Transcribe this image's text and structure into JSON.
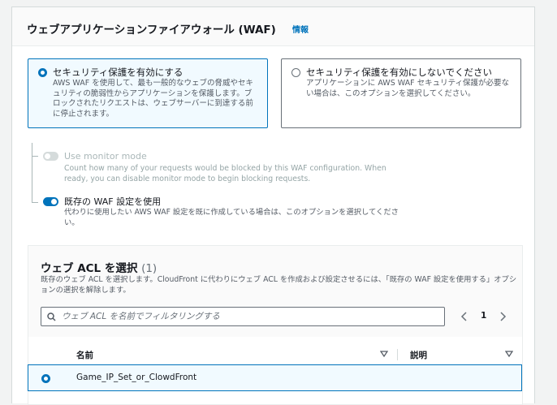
{
  "panel": {
    "title": "ウェブアプリケーションファイアウォール (WAF)",
    "info_link": "情報"
  },
  "protection_options": [
    {
      "label": "セキュリティ保護を有効にする",
      "description": "AWS WAF を使用して、最も一般的なウェブの脅威やセキュリティの脆弱性からアプリケーションを保護します。ブロックされたリクエストは、ウェブサーバーに到達する前に停止されます。",
      "selected": true
    },
    {
      "label": "セキュリティ保護を有効にしないでください",
      "description": "アプリケーションに AWS WAF セキュリティ保護が必要ない場合は、このオプションを選択してください。",
      "selected": false
    }
  ],
  "monitor_mode": {
    "label": "Use monitor mode",
    "description": "Count how many of your requests would be blocked by this WAF configuration. When ready, you can disable monitor mode to begin blocking requests.",
    "enabled": false
  },
  "existing_waf": {
    "label": "既存の WAF 設定を使用",
    "description": "代わりに使用したい AWS WAF 設定を既に作成している場合は、このオプションを選択してください。",
    "enabled": true
  },
  "web_acl": {
    "title": "ウェブ ACL を選択",
    "count": "(1)",
    "description": "既存のウェブ ACL を選択します。CloudFront に代わりにウェブ ACL を作成および設定させるには、「既存の WAF 設定を使用する」オプションの選択を解除します。",
    "search_placeholder": "ウェブ ACL を名前でフィルタリングする",
    "page": "1",
    "columns": [
      "名前",
      "説明"
    ],
    "rows": [
      {
        "name": "Game_IP_Set_or_ClowdFront",
        "description": "",
        "selected": true
      }
    ]
  },
  "colors": {
    "accent": "#0073bb",
    "selected_bg": "#f1faff",
    "border": "#687078"
  },
  "icons": [
    "search-icon",
    "chevron-left-icon",
    "chevron-right-icon",
    "sort-icon"
  ]
}
